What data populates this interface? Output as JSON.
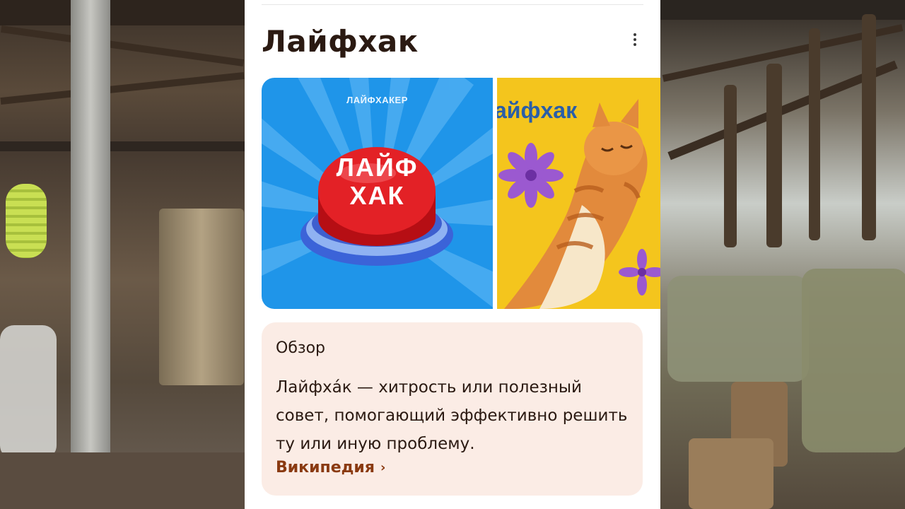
{
  "card": {
    "title": "Лайфхак",
    "menu_icon": "more-vert-icon"
  },
  "images": [
    {
      "brand": "ЛАЙФХАКЕР",
      "button_line1": "ЛАЙФ",
      "button_line2": "ХАК",
      "colors": {
        "background": "#1f95e9",
        "button": "#d4171c",
        "base": "#3b63d8"
      }
    },
    {
      "caption": "айфхак",
      "colors": {
        "background": "#f4c51d",
        "text": "#2a5ea8",
        "flower": "#9b59d0",
        "cat": "#e28a3c"
      }
    }
  ],
  "overview": {
    "heading": "Обзор",
    "text": "Лайфха́к — хитрость или полезный совет, помогающий эффективно решить ту или иную проблему.",
    "link": "Википедия",
    "link_icon": "chevron-right-icon"
  },
  "colors": {
    "overview_bg": "#fbece5",
    "link": "#8a3a11",
    "title": "#2b1a12"
  }
}
